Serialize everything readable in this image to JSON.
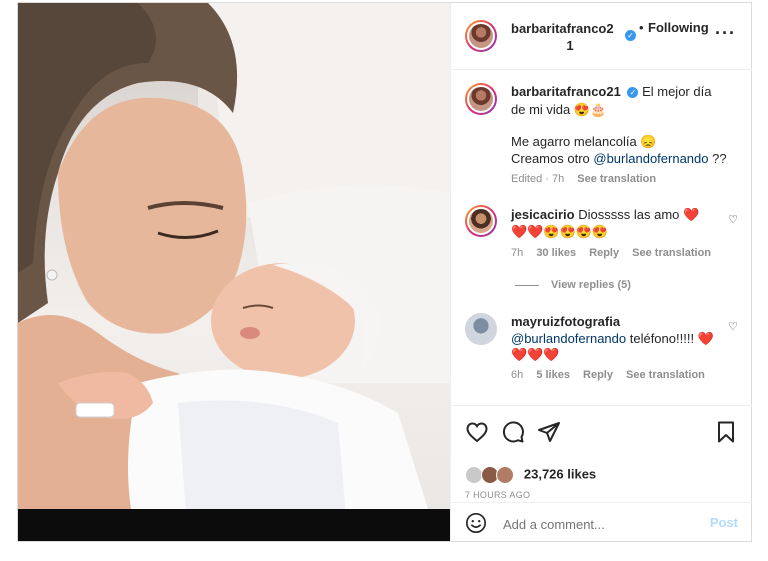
{
  "post": {
    "header": {
      "username": "barbaritafranco2",
      "username_wrap": "1",
      "separator": "•",
      "follow_label": "Following",
      "more_label": "···"
    },
    "caption": {
      "username": "barbaritafranco21",
      "text": "El mejor día de mi vida 😍🎂",
      "line2": "Me agarro melancolía 😞",
      "line3_prefix": "Creamos otro ",
      "line3_mention": "@burlandofernando",
      "line3_suffix": " ??",
      "meta_edited": "Edited · 7h",
      "meta_translate": "See translation"
    },
    "comments": [
      {
        "username": "jesicacirio",
        "text": "Diosssss las amo ❤️",
        "text_line2": "❤️❤️😍😍😍😍",
        "time": "7h",
        "likes": "30 likes",
        "reply": "Reply",
        "translate": "See translation",
        "view_replies": "View replies (5)"
      },
      {
        "username": "mayruizfotografia",
        "mention": "@burlandofernando",
        "text": " teléfono!!!!! ❤️",
        "text_line2": "❤️❤️❤️",
        "time": "6h",
        "likes": "5 likes",
        "reply": "Reply",
        "translate": "See translation"
      }
    ],
    "likes": "23,726 likes",
    "time_ago": "7 HOURS AGO",
    "comment_placeholder": "Add a comment...",
    "post_label": "Post",
    "icons": {
      "like": "heart-icon",
      "comment": "comment-icon",
      "share": "share-icon",
      "save": "bookmark-icon",
      "emoji": "emoji-icon"
    },
    "colors": {
      "link": "#00376b",
      "verified": "#3897f0",
      "muted": "#8e8e8e",
      "post_disabled": "#b3dbff"
    }
  }
}
